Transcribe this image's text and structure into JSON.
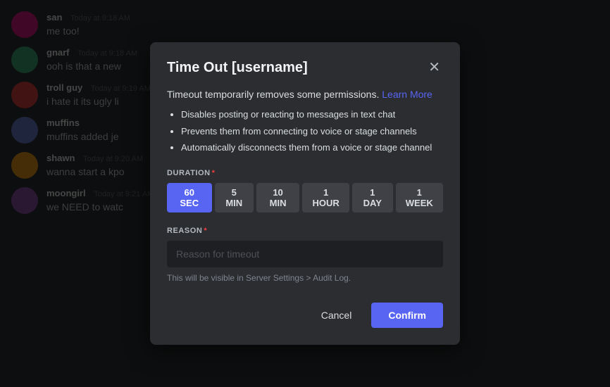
{
  "chat": {
    "messages": [
      {
        "id": "san",
        "username": "san",
        "timestamp": "Today at 9:18 AM",
        "text": "me too!",
        "avatarClass": "avatar-san"
      },
      {
        "id": "gnarf",
        "username": "gnarf",
        "timestamp": "Today at 9:18 AM",
        "text": "ooh is that a new",
        "avatarClass": "avatar-gnarf"
      },
      {
        "id": "troll",
        "username": "troll guy",
        "timestamp": "Today at 9:19 AM",
        "text": "i hate it its ugly li",
        "avatarClass": "avatar-troll"
      },
      {
        "id": "muffins",
        "username": "muffins",
        "timestamp": "",
        "text": "muffins added je",
        "avatarClass": "avatar-muffins"
      },
      {
        "id": "shawn",
        "username": "shawn",
        "timestamp": "Today at 9:20 AM",
        "text": "wanna start a kpo",
        "avatarClass": "avatar-shawn"
      },
      {
        "id": "moongirl",
        "username": "moongirl",
        "timestamp": "Today at 9:21 AM",
        "text": "we NEED to watc",
        "avatarClass": "avatar-moongirl"
      }
    ]
  },
  "modal": {
    "title": "Time Out [username]",
    "description": "Timeout temporarily removes some permissions.",
    "learn_more_label": "Learn More",
    "bullets": [
      "Disables posting or reacting to messages in text chat",
      "Prevents them from connecting to voice or stage channels",
      "Automatically disconnects them from a voice or stage channel"
    ],
    "duration_label": "DURATION",
    "duration_options": [
      {
        "label": "60 SEC",
        "active": true
      },
      {
        "label": "5 MIN",
        "active": false
      },
      {
        "label": "10 MIN",
        "active": false
      },
      {
        "label": "1 HOUR",
        "active": false
      },
      {
        "label": "1 DAY",
        "active": false
      },
      {
        "label": "1 WEEK",
        "active": false
      }
    ],
    "reason_label": "REASON",
    "reason_placeholder": "Reason for timeout",
    "audit_note": "This will be visible in Server Settings > Audit Log.",
    "cancel_label": "Cancel",
    "confirm_label": "Confirm"
  }
}
